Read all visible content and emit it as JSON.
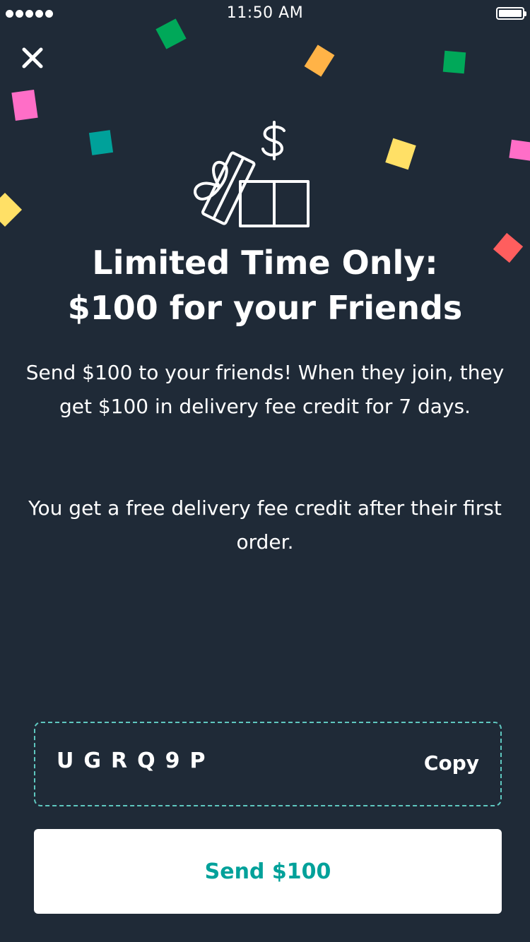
{
  "status_bar": {
    "time": "11:50 AM"
  },
  "icons": {
    "close": "close-icon",
    "gift": "gift-icon",
    "dollar": "dollar-icon"
  },
  "headline": {
    "line1": "Limited Time Only:",
    "line2": "$100 for your Friends"
  },
  "body": {
    "paragraph1": "Send $100 to your friends! When they join, they get $100 in delivery fee credit for 7 days.",
    "paragraph2": "You get a free delivery fee credit after their first order."
  },
  "referral": {
    "code": "UGRQ9P",
    "copy_label": "Copy"
  },
  "send_button": {
    "label": "Send $100"
  },
  "colors": {
    "background": "#1f2a37",
    "accent": "#00a19a",
    "dashed_border": "#5fc7bf",
    "confetti_green": "#00a859",
    "confetti_orange": "#ffb347",
    "confetti_pink": "#ff6ec7",
    "confetti_teal": "#00a19a",
    "confetti_yellow": "#ffe066",
    "confetti_red": "#ff5e5e"
  }
}
